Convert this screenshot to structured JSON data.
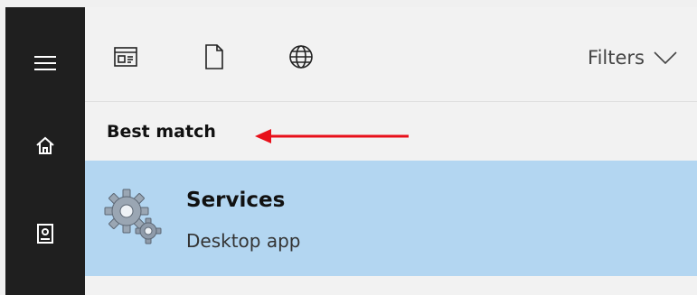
{
  "toolbar": {
    "tabs": [
      {
        "icon": "apps-icon"
      },
      {
        "icon": "document-icon"
      },
      {
        "icon": "globe-icon"
      }
    ],
    "filters_label": "Filters"
  },
  "section": {
    "heading": "Best match"
  },
  "result": {
    "title": "Services",
    "subtitle": "Desktop app",
    "icon": "services-gears-icon"
  },
  "rail": {
    "items": [
      {
        "icon": "hamburger-menu-icon"
      },
      {
        "icon": "home-icon"
      },
      {
        "icon": "notebook-icon"
      }
    ]
  },
  "colors": {
    "rail_bg": "#1f1f1f",
    "panel_bg": "#f2f2f2",
    "selected_result_bg": "#b3d6f1",
    "annotation_arrow": "#e8101a"
  }
}
